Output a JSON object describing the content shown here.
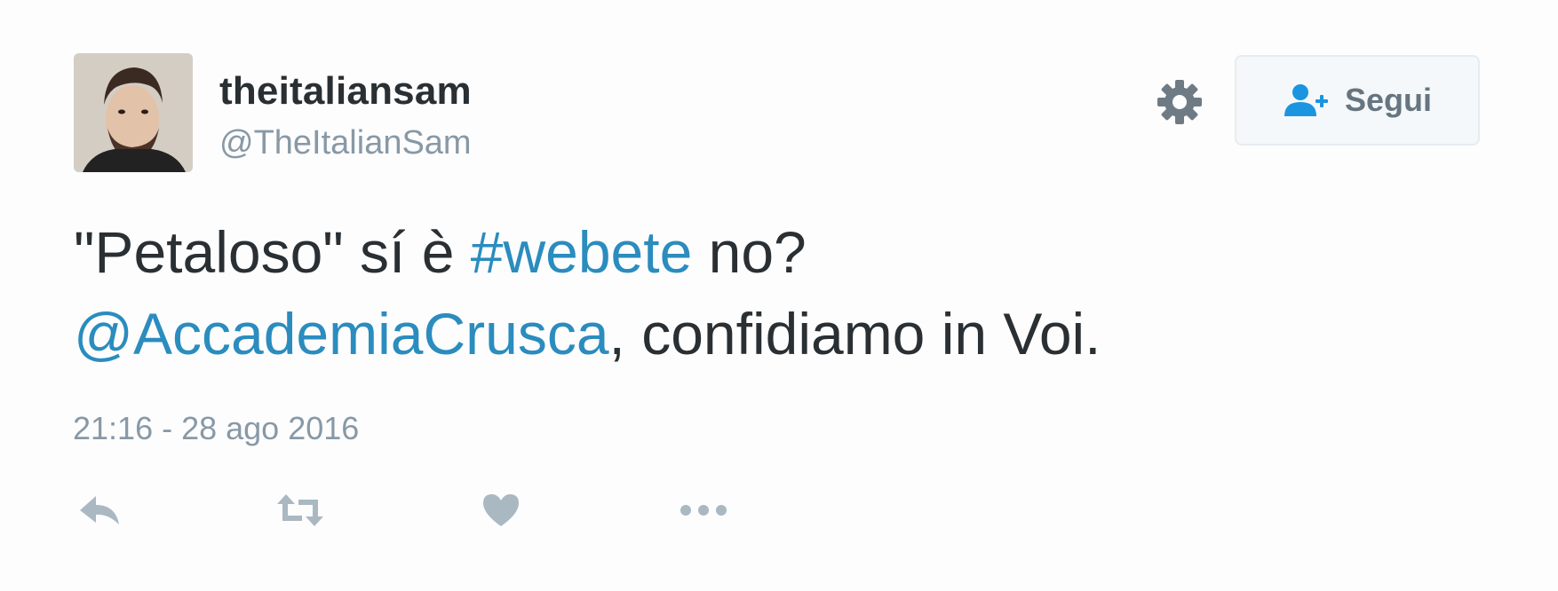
{
  "user": {
    "display_name": "theitaliansam",
    "handle": "@TheItalianSam"
  },
  "follow_button": {
    "label": "Segui"
  },
  "tweet": {
    "line1_part1": "\"Petaloso\" sí è ",
    "hashtag": "#webete",
    "line1_part2": " no?",
    "mention": "@AccademiaCrusca",
    "line2_part2": ", confidiamo in Voi.",
    "timestamp": "21:16 - 28 ago 2016"
  },
  "icons": {
    "settings": "gear-icon",
    "follow": "add-user-icon",
    "reply": "reply-icon",
    "retweet": "retweet-icon",
    "like": "heart-icon",
    "more": "more-dots-icon"
  },
  "colors": {
    "link": "#2b8cbe",
    "text": "#292f33",
    "muted": "#8899a6",
    "action_icons": "#aab8c2",
    "follow_icon": "#1b95e0"
  }
}
